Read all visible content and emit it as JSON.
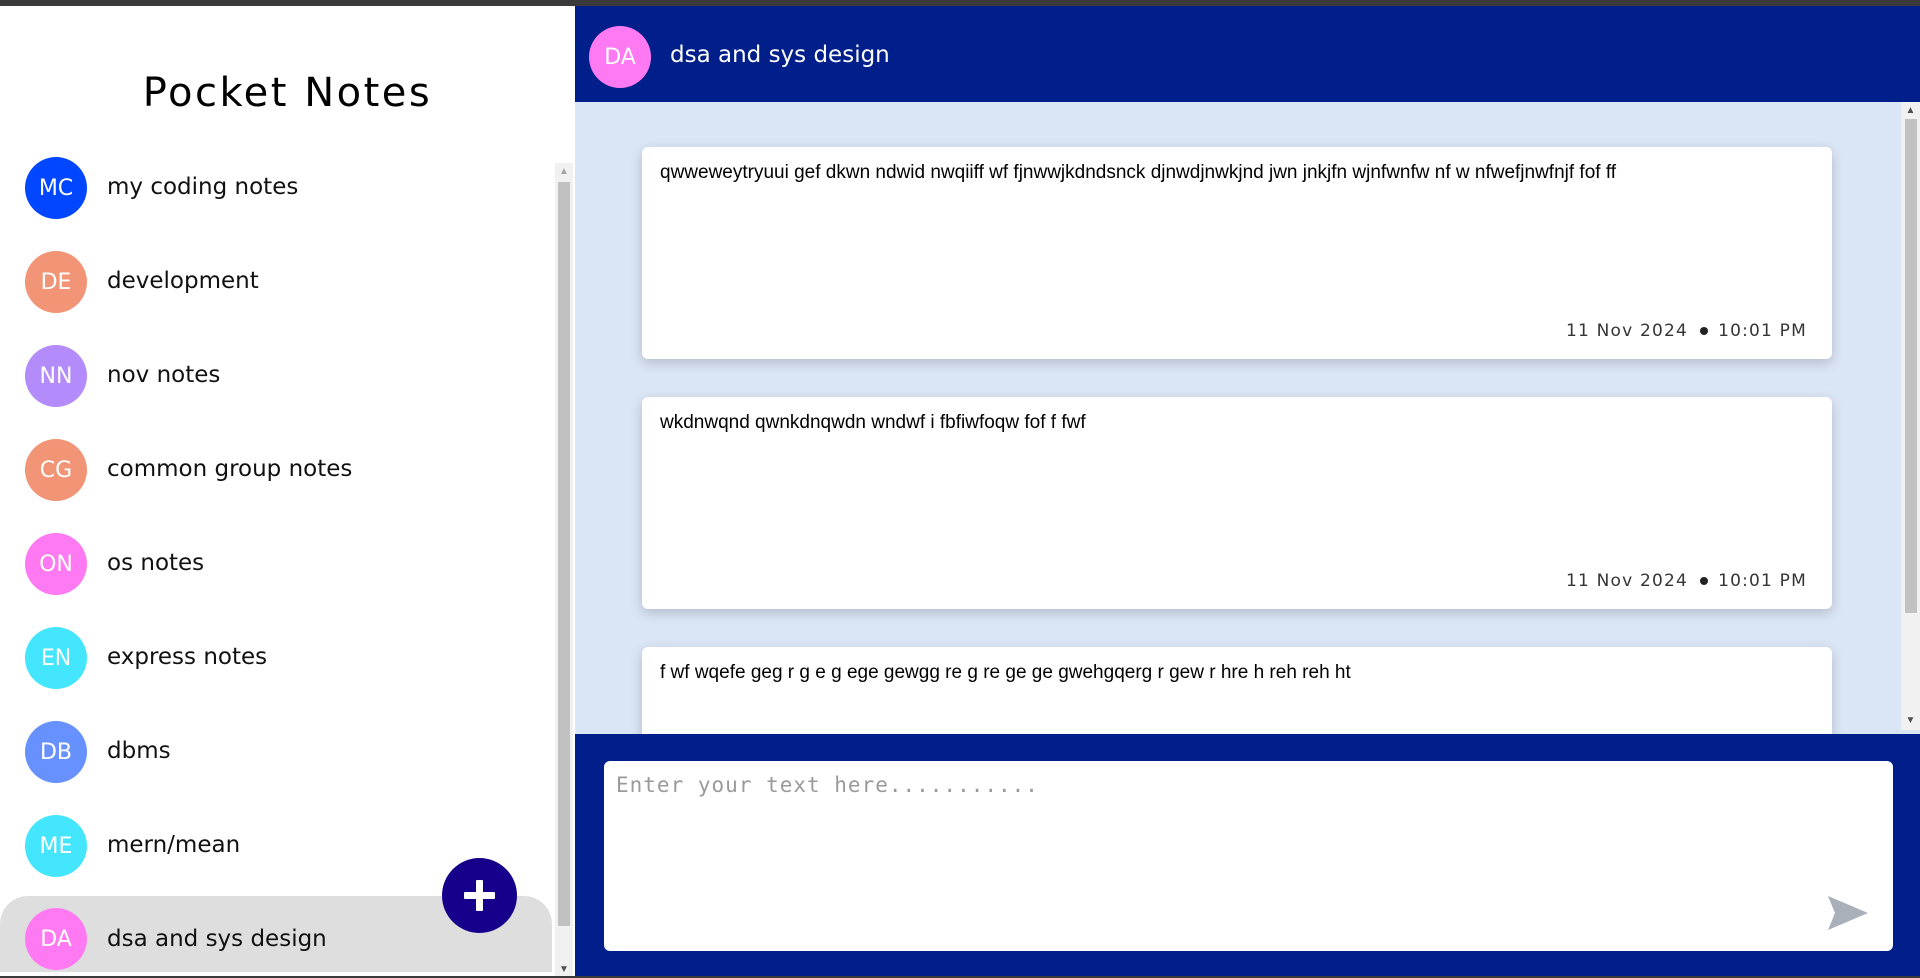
{
  "app": {
    "title": "Pocket Notes"
  },
  "groups": [
    {
      "initials": "MC",
      "name": "my coding notes",
      "color": "#0047ff"
    },
    {
      "initials": "DE",
      "name": "development",
      "color": "#f19576"
    },
    {
      "initials": "NN",
      "name": "nov notes",
      "color": "#b38bfa"
    },
    {
      "initials": "CG",
      "name": "common group notes",
      "color": "#f19576"
    },
    {
      "initials": "ON",
      "name": "os notes",
      "color": "#ff79f2"
    },
    {
      "initials": "EN",
      "name": "express notes",
      "color": "#43e6fc"
    },
    {
      "initials": "DB",
      "name": "dbms",
      "color": "#6691ff"
    },
    {
      "initials": "ME",
      "name": "mern/mean",
      "color": "#43e6fc"
    },
    {
      "initials": "DA",
      "name": "dsa and sys design",
      "color": "#ff79f2",
      "active": true
    }
  ],
  "add_button": {
    "label": "+"
  },
  "header": {
    "initials": "DA",
    "title": "dsa and sys design",
    "avatar_color": "#ff79f2"
  },
  "notes": [
    {
      "text": "qwweweytryuui gef dkwn ndwid nwqiiff wf fjnwwjkdndsnck djnwdjnwkjnd jwn jnkjfn wjnfwnfw nf w nfwefjnwfnjf fof ff",
      "date": "11 Nov 2024",
      "time": "10:01 PM"
    },
    {
      "text": "wkdnwqnd qwnkdnqwdn wndwf i fbfiwfoqw fof f fwf",
      "date": "11 Nov 2024",
      "time": "10:01 PM"
    },
    {
      "text": "f wf wqefe geg r g e g ege gewgg re g re ge ge gwehgqerg r gew r hre h reh reh ht",
      "date": "",
      "time": ""
    }
  ],
  "composer": {
    "placeholder": "Enter your text here...........",
    "value": ""
  },
  "colors": {
    "accent": "#001f8b",
    "fab": "#16008b",
    "chat_bg": "#dae5f5",
    "active_item": "#dedede"
  }
}
